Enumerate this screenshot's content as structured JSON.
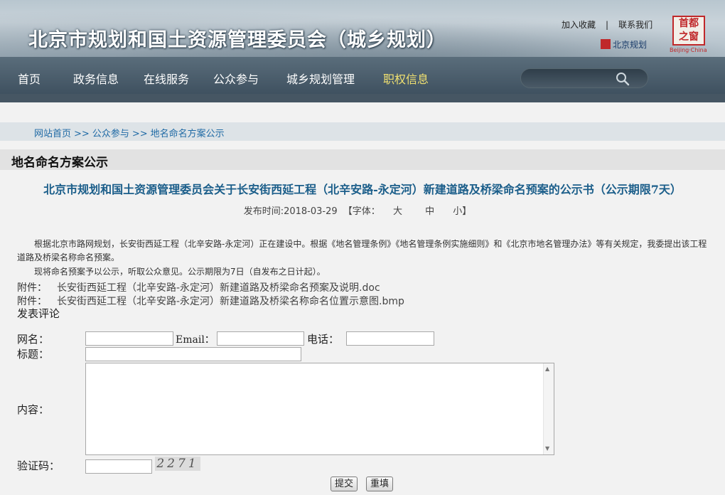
{
  "header": {
    "site_title": "北京市规划和国土资源管理委员会（城乡规划）",
    "add_favorite": "加入收藏",
    "separator": "|",
    "contact_us": "联系我们",
    "sub_brand": "北京规划",
    "logo_text_1": "首都",
    "logo_text_2": "之窗",
    "logo_sub": "Beijing·China"
  },
  "nav": {
    "items": [
      "首页",
      "政务信息",
      "在线服务",
      "公众参与",
      "城乡规划管理",
      "职权信息"
    ],
    "active_index": 5,
    "search_placeholder": ""
  },
  "breadcrumb": {
    "items": [
      "网站首页",
      "公众参与",
      "地名命名方案公示"
    ],
    "separator": ">>"
  },
  "section": {
    "title": "地名命名方案公示"
  },
  "article": {
    "title": "北京市规划和国土资源管理委员会关于长安街西延工程（北辛安路-永定河）新建道路及桥梁命名预案的公示书（公示期限7天）",
    "publish_label": "发布时间:2018-03-29",
    "font_label": "【字体：",
    "font_large": "大",
    "font_medium": "中",
    "font_small": "小】",
    "paragraph1": "根据北京市路网规划，长安街西延工程（北辛安路-永定河）正在建设中。根据《地名管理条例》《地名管理条例实施细则》和《北京市地名管理办法》等有关规定，我委提出该工程道路及桥梁名称命名预案。",
    "paragraph2": "现将命名预案予以公示，听取公众意见。公示期限为7日（自发布之日计起）。",
    "attachments": [
      {
        "label": "附件：",
        "file": "长安街西延工程（北辛安路-永定河）新建道路及桥梁命名预案及说明.doc"
      },
      {
        "label": "附件：",
        "file": "长安街西延工程（北辛安路-永定河）新建道路及桥梁名称命名位置示意图.bmp"
      }
    ]
  },
  "comment_form": {
    "heading": "发表评论",
    "name_label": "网名：",
    "email_label": "Email：",
    "phone_label": "电话：",
    "subject_label": "标题：",
    "content_label": "内容：",
    "captcha_label": "验证码：",
    "captcha_value": "2271",
    "name_value": "",
    "email_value": "",
    "phone_value": "",
    "subject_value": "",
    "content_value": "",
    "captcha_input_value": "",
    "submit_label": "提交",
    "reset_label": "重填"
  },
  "colors": {
    "nav_bg": "#4c5e6c",
    "nav_active": "#f0e070",
    "breadcrumb_link": "#1f6aa5",
    "article_title": "#1b5e8a",
    "brand_red": "#c0282a"
  }
}
